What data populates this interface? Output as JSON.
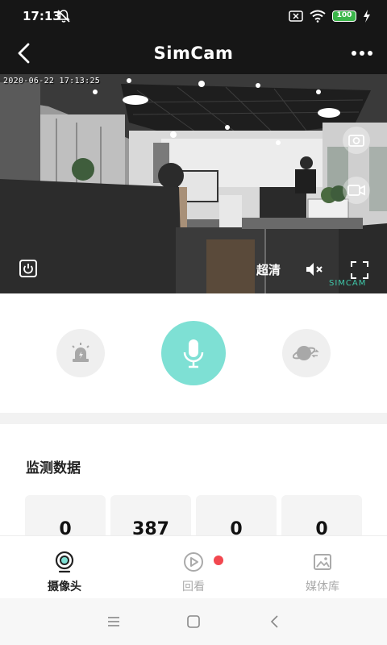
{
  "status_bar": {
    "time": "17:13",
    "battery": "100"
  },
  "header": {
    "title": "SimCam"
  },
  "video": {
    "timestamp": "2020-06-22 17:13:25",
    "quality_label": "超清",
    "watermark": "SIMCAM"
  },
  "monitor": {
    "title": "监测数据",
    "stats": [
      "0",
      "387",
      "0",
      "0"
    ]
  },
  "tabs": [
    {
      "label": "摄像头",
      "active": true
    },
    {
      "label": "回看",
      "active": false
    },
    {
      "label": "媒体库",
      "active": false
    }
  ],
  "colors": {
    "accent": "#7ee0d4",
    "tab_active": "#222222",
    "tab_inactive": "#aaaaaa",
    "badge": "#f2474f",
    "bar_bg": "#161616"
  }
}
